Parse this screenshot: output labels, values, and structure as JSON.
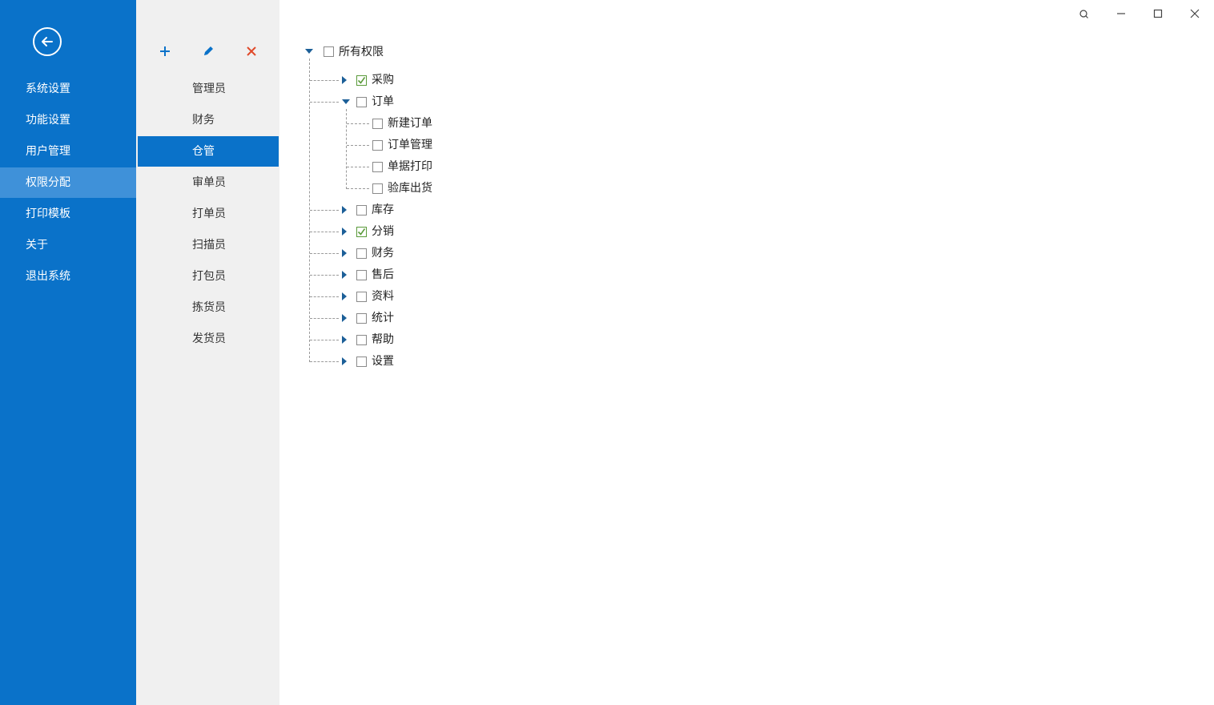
{
  "nav": {
    "back_icon": "arrow-left-circle-icon",
    "items": [
      {
        "label": "系统设置",
        "active": false
      },
      {
        "label": "功能设置",
        "active": false
      },
      {
        "label": "用户管理",
        "active": false
      },
      {
        "label": "权限分配",
        "active": true
      },
      {
        "label": "打印模板",
        "active": false
      },
      {
        "label": "关于",
        "active": false
      },
      {
        "label": "退出系统",
        "active": false
      }
    ]
  },
  "roles": {
    "toolbar": {
      "add_icon": "plus-icon",
      "edit_icon": "pencil-icon",
      "delete_icon": "close-icon"
    },
    "items": [
      {
        "label": "管理员",
        "active": false
      },
      {
        "label": "财务",
        "active": false
      },
      {
        "label": "仓管",
        "active": true
      },
      {
        "label": "审单员",
        "active": false
      },
      {
        "label": "打单员",
        "active": false
      },
      {
        "label": "扫描员",
        "active": false
      },
      {
        "label": "打包员",
        "active": false
      },
      {
        "label": "拣货员",
        "active": false
      },
      {
        "label": "发货员",
        "active": false
      }
    ]
  },
  "tree": {
    "root": {
      "label": "所有权限",
      "checked": false,
      "expanded": true
    },
    "children": [
      {
        "label": "采购",
        "checked": true,
        "expanded": false
      },
      {
        "label": "订单",
        "checked": false,
        "expanded": true,
        "children": [
          {
            "label": "新建订单",
            "checked": false
          },
          {
            "label": "订单管理",
            "checked": false
          },
          {
            "label": "单据打印",
            "checked": false
          },
          {
            "label": "验库出货",
            "checked": false
          }
        ]
      },
      {
        "label": "库存",
        "checked": false,
        "expanded": false
      },
      {
        "label": "分销",
        "checked": true,
        "expanded": false
      },
      {
        "label": "财务",
        "checked": false,
        "expanded": false
      },
      {
        "label": "售后",
        "checked": false,
        "expanded": false
      },
      {
        "label": "资料",
        "checked": false,
        "expanded": false
      },
      {
        "label": "统计",
        "checked": false,
        "expanded": false
      },
      {
        "label": "帮助",
        "checked": false,
        "expanded": false
      },
      {
        "label": "设置",
        "checked": false,
        "expanded": false
      }
    ]
  },
  "window_controls": [
    "search-icon",
    "minimize-icon",
    "maximize-icon",
    "close-icon"
  ],
  "colors": {
    "accent": "#0a72c9",
    "nav_active": "#3f91d9",
    "check": "#5a9a3a",
    "delete": "#e04a2a"
  }
}
